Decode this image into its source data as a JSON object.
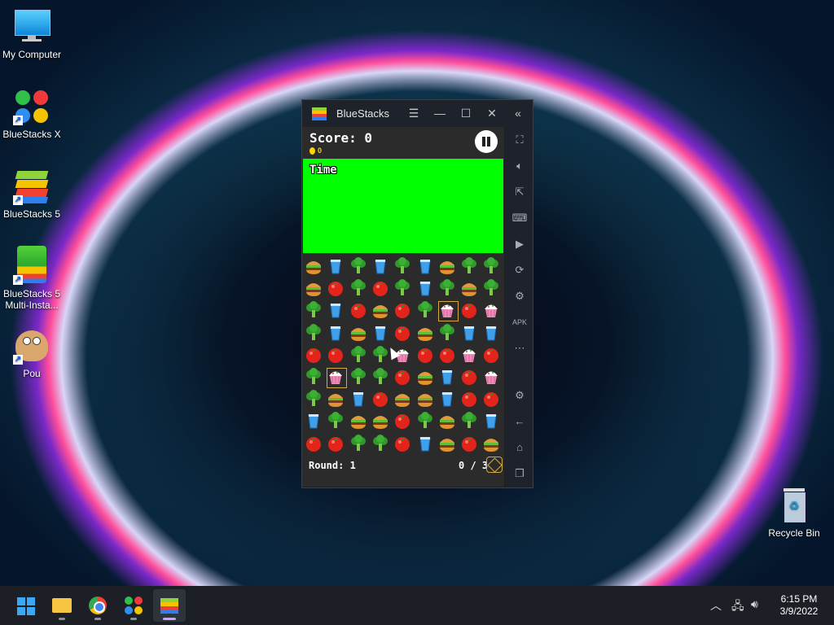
{
  "desktop": {
    "icons": [
      {
        "label": "My Computer",
        "icon": "monitor-icon"
      },
      {
        "label": "BlueStacks X",
        "icon": "bluestacks-x-icon"
      },
      {
        "label": "BlueStacks 5",
        "icon": "bluestacks-5-icon"
      },
      {
        "label": "BlueStacks 5\nMulti-Insta...",
        "icon": "bluestacks-multi-instance-icon"
      },
      {
        "label": "Pou",
        "icon": "pou-icon"
      },
      {
        "label": "Recycle Bin",
        "icon": "recycle-bin-icon"
      }
    ]
  },
  "window": {
    "title": "BlueStacks",
    "controls": [
      "menu-icon",
      "minimize-icon",
      "maximize-icon",
      "close-icon",
      "collapse-icon"
    ],
    "sidebar": [
      "fullscreen-icon",
      "volume-icon",
      "cursor-icon",
      "keyboard-icon",
      "record-icon",
      "rotate-icon",
      "macro-icon",
      "apk-icon",
      "more-icon",
      "settings-icon",
      "back-icon",
      "home-icon",
      "recent-apps-icon"
    ]
  },
  "game": {
    "score": "Score: 0",
    "coins": "0",
    "time_label": "Time",
    "round": "Round: 1",
    "progress": "0 / 3",
    "timer_color": "#00ff00",
    "board": [
      [
        "B",
        "C",
        "R",
        "C",
        "R",
        "C",
        "B",
        "R",
        "R"
      ],
      [
        "B",
        "T",
        "R",
        "T",
        "R",
        "C",
        "R",
        "B",
        "R"
      ],
      [
        "R",
        "C",
        "T",
        "B",
        "T",
        "R",
        "K",
        "T",
        "K"
      ],
      [
        "R",
        "C",
        "B",
        "C",
        "T",
        "B",
        "R",
        "C",
        "C"
      ],
      [
        "T",
        "T",
        "R",
        "R",
        "K",
        "T",
        "T",
        "K",
        "T"
      ],
      [
        "R",
        "K",
        "R",
        "R",
        "T",
        "B",
        "C",
        "T",
        "K"
      ],
      [
        "R",
        "B",
        "C",
        "T",
        "B",
        "B",
        "C",
        "T",
        "T"
      ],
      [
        "C",
        "R",
        "B",
        "B",
        "T",
        "R",
        "B",
        "R",
        "C"
      ],
      [
        "T",
        "T",
        "R",
        "R",
        "T",
        "C",
        "B",
        "T",
        "B"
      ]
    ],
    "legend": {
      "B": "burger",
      "C": "cup",
      "R": "broccoli",
      "T": "tomato",
      "K": "cupcake"
    },
    "selected_cells": [
      "2-6",
      "5-1"
    ]
  },
  "taskbar": {
    "apps": [
      "start-icon",
      "file-explorer-icon",
      "chrome-icon",
      "bluestacks-x-icon",
      "bluestacks-5-icon"
    ],
    "active_index": 4,
    "time": "6:15 PM",
    "date": "3/9/2022"
  }
}
